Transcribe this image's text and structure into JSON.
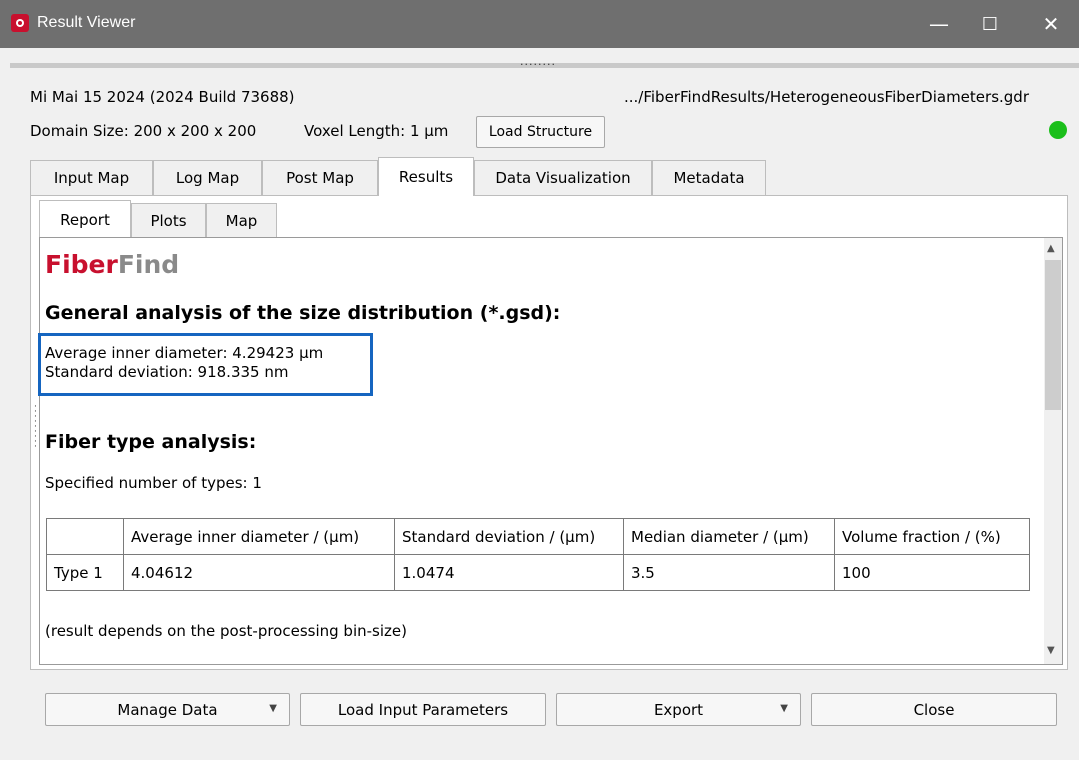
{
  "window": {
    "title": "Result Viewer",
    "controls": {
      "minimize": "—",
      "maximize": "☐",
      "close": "✕"
    }
  },
  "header": {
    "date_build": "Mi Mai 15 2024 (2024 Build 73688)",
    "file_path": ".../FiberFindResults/HeterogeneousFiberDiameters.gdr",
    "domain_size": "Domain Size: 200 x 200 x 200",
    "voxel_length": "Voxel Length: 1 µm",
    "load_structure_label": "Load Structure",
    "status_color": "#1bbf1b"
  },
  "tabs": [
    {
      "label": "Input Map"
    },
    {
      "label": "Log Map"
    },
    {
      "label": "Post Map"
    },
    {
      "label": "Results",
      "active": true
    },
    {
      "label": "Data Visualization"
    },
    {
      "label": "Metadata"
    }
  ],
  "subtabs": [
    {
      "label": "Report",
      "active": true
    },
    {
      "label": "Plots"
    },
    {
      "label": "Map"
    }
  ],
  "report": {
    "logo_part1": "Fiber",
    "logo_part2": "Find",
    "gsd_heading": "General analysis of the size distribution (*.gsd):",
    "avg_inner_diameter": "Average inner diameter: 4.29423 µm",
    "std_deviation": "Standard deviation: 918.335 nm",
    "fiber_type_heading": "Fiber type analysis:",
    "num_types": "Specified number of types: 1",
    "table": {
      "headers": [
        "",
        "Average inner diameter / (µm)",
        "Standard deviation / (µm)",
        "Median diameter / (µm)",
        "Volume fraction / (%)"
      ],
      "rows": [
        [
          "Type 1",
          "4.04612",
          "1.0474",
          "3.5",
          "100"
        ]
      ]
    },
    "note": "(result depends on the post-processing bin-size)"
  },
  "footer": {
    "manage_data": "Manage Data",
    "load_input_parameters": "Load Input Parameters",
    "export": "Export",
    "close": "Close"
  }
}
